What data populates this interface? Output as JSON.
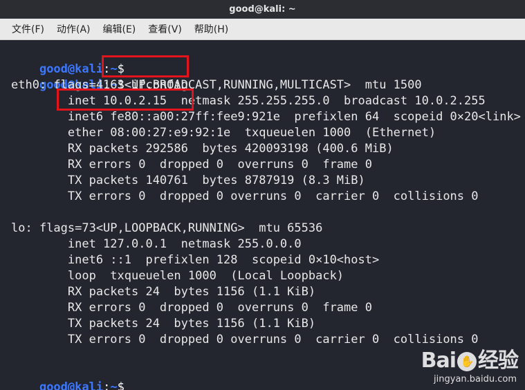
{
  "window": {
    "title": "good@kali: ~"
  },
  "menubar": {
    "items": [
      "文件(F)",
      "动作(A)",
      "编辑(E)",
      "查看(V)",
      "帮助(H)"
    ]
  },
  "terminal": {
    "prompt_user_host": "good@kali",
    "prompt_sep": ":",
    "prompt_path": "~",
    "prompt_end": "$",
    "command": " ifconfig",
    "lines": [
      "eth0: flags=4163<UP,BROADCAST,RUNNING,MULTICAST>  mtu 1500",
      "        inet 10.0.2.15  netmask 255.255.255.0  broadcast 10.0.2.255",
      "        inet6 fe80::a00:27ff:fee9:921e  prefixlen 64  scopeid 0×20<link>",
      "        ether 08:00:27:e9:92:1e  txqueuelen 1000  (Ethernet)",
      "        RX packets 292586  bytes 420093198 (400.6 MiB)",
      "        RX errors 0  dropped 0  overruns 0  frame 0",
      "        TX packets 140761  bytes 8787919 (8.3 MiB)",
      "        TX errors 0  dropped 0 overruns 0  carrier 0  collisions 0",
      "",
      "lo: flags=73<UP,LOOPBACK,RUNNING>  mtu 65536",
      "        inet 127.0.0.1  netmask 255.0.0.0",
      "        inet6 ::1  prefixlen 128  scopeid 0×10<host>",
      "        loop  txqueuelen 1000  (Local Loopback)",
      "        RX packets 24  bytes 1156 (1.1 KiB)",
      "        RX errors 0  dropped 0  overruns 0  frame 0",
      "        TX packets 24  bytes 1156 (1.1 KiB)",
      "        TX errors 0  dropped 0 overruns 0  carrier 0  collisions 0"
    ]
  },
  "watermark": {
    "logo_left": "Bai",
    "logo_paw": "du",
    "logo_right": "经验",
    "url": "jingyan.baidu.com"
  },
  "colors": {
    "accent": "#3b78ff",
    "highlight": "#e3141c",
    "background": "#23252f"
  }
}
